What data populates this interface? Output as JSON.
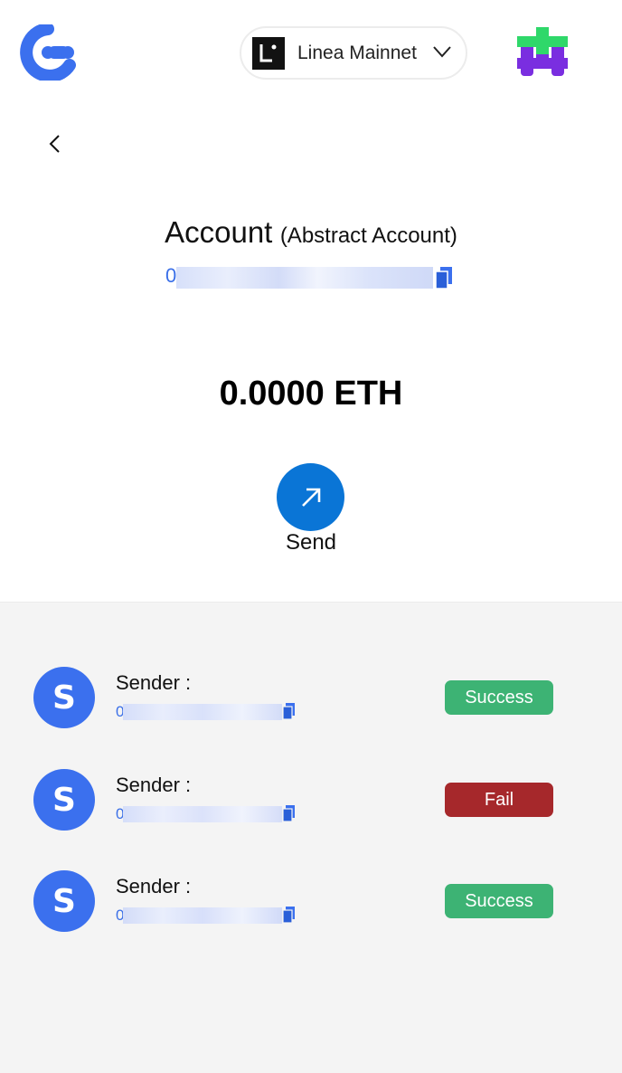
{
  "header": {
    "network": {
      "name": "Linea Mainnet",
      "icon": "linea-logo-icon"
    },
    "logo_icon": "app-logo-icon",
    "avatar_icon": "user-avatar-icon"
  },
  "account": {
    "title": "Account",
    "type": "(Abstract Account)",
    "address_prefix": "0"
  },
  "balance": "0.0000 ETH",
  "actions": {
    "send_label": "Send"
  },
  "transactions": [
    {
      "avatar_letter": "S",
      "sender_label": "Sender :",
      "address_prefix": "0",
      "status": "Success",
      "status_color": "#3db374"
    },
    {
      "avatar_letter": "S",
      "sender_label": "Sender :",
      "address_prefix": "0",
      "status": "Fail",
      "status_color": "#a6282b"
    },
    {
      "avatar_letter": "S",
      "sender_label": "Sender :",
      "address_prefix": "0",
      "status": "Success",
      "status_color": "#3db374"
    }
  ],
  "colors": {
    "accent": "#3b70ee",
    "send": "#0a75d6",
    "panel": "#f4f4f4"
  }
}
